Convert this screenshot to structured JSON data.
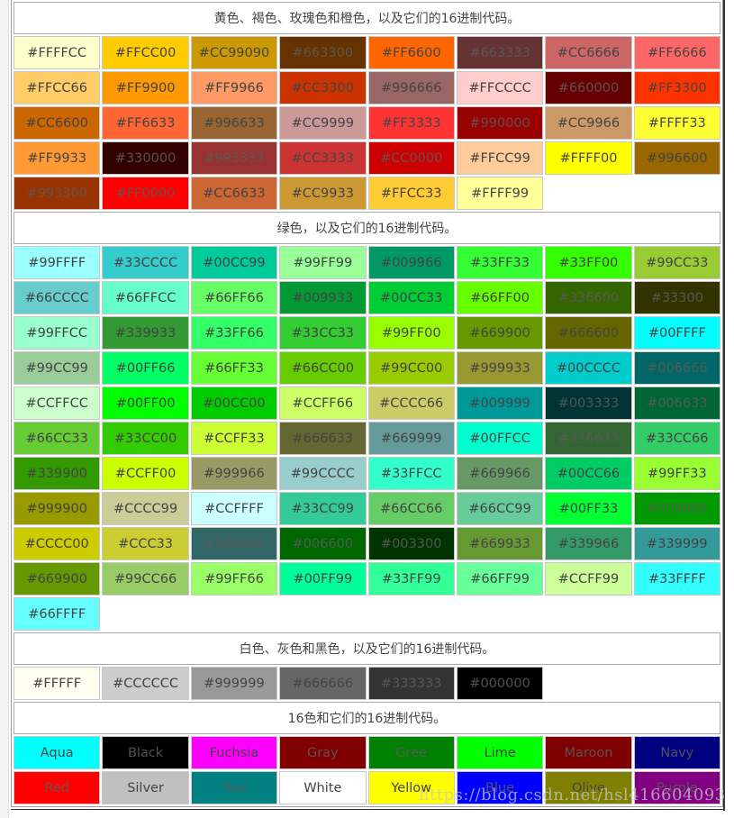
{
  "sections": [
    {
      "title": "黄色、褐色、玫瑰色和橙色，以及它们的16进制代码。",
      "rows": [
        [
          "#FFFFCC",
          "#FFCC00",
          "#CC99090",
          "#663300",
          "#FF6600",
          "#663333",
          "#CC6666",
          "#FF6666"
        ],
        [
          "#FFCC66",
          "#FF9900",
          "#FF9966",
          "#CC3300",
          "#996666",
          "#FFCCCC",
          "#660000",
          "#FF3300"
        ],
        [
          "#CC6600",
          "#FF6633",
          "#996633",
          "#CC9999",
          "#FF3333",
          "#990000",
          "#CC9966",
          "#FFFF33"
        ],
        [
          "#FF9933",
          "#330000",
          "#993333",
          "#CC3333",
          "#CC0000",
          "#FFCC99",
          "#FFFF00",
          "#996600"
        ],
        [
          "#993300",
          "#FF0000",
          "#CC6633",
          "#CC9933",
          "#FFCC33",
          "#FFFF99"
        ]
      ],
      "colors": [
        [
          "#FFFFCC",
          "#FFCC00",
          "#CC9900",
          "#663300",
          "#FF6600",
          "#663333",
          "#CC6666",
          "#FF6666"
        ],
        [
          "#FFCC66",
          "#FF9900",
          "#FF9966",
          "#CC3300",
          "#996666",
          "#FFCCCC",
          "#660000",
          "#FF3300"
        ],
        [
          "#CC6600",
          "#FF6633",
          "#996633",
          "#CC9999",
          "#FF3333",
          "#990000",
          "#CC9966",
          "#FFFF33"
        ],
        [
          "#FF9933",
          "#330000",
          "#993333",
          "#CC3333",
          "#CC0000",
          "#FFCC99",
          "#FFFF00",
          "#996600"
        ],
        [
          "#993300",
          "#FF0000",
          "#CC6633",
          "#CC9933",
          "#FFCC33",
          "#FFFF99"
        ]
      ]
    },
    {
      "title": "绿色，以及它们的16进制代码。",
      "rows": [
        [
          "#99FFFF",
          "#33CCCC",
          "#00CC99",
          "#99FF99",
          "#009966",
          "#33FF33",
          "#33FF00",
          "#99CC33"
        ],
        [
          "#66CCCC",
          "#66FFCC",
          "#66FF66",
          "#009933",
          "#00CC33",
          "#66FF00",
          "#336600",
          "#33300"
        ],
        [
          "#99FFCC",
          "#339933",
          "#33FF66",
          "#33CC33",
          "#99FF00",
          "#669900",
          "#666600",
          "#00FFFF"
        ],
        [
          "#99CC99",
          "#00FF66",
          "#66FF33",
          "#66CC00",
          "#99CC00",
          "#999933",
          "#00CCCC",
          "#006666"
        ],
        [
          "#CCFFCC",
          "#00FF00",
          "#00CC00",
          "#CCFF66",
          "#CCCC66",
          "#009999",
          "#003333",
          "#006633"
        ],
        [
          "#66CC33",
          "#33CC00",
          "#CCFF33",
          "#666633",
          "#669999",
          "#00FFCC",
          "#336633",
          "#33CC66"
        ],
        [
          "#339900",
          "#CCFF00",
          "#999966",
          "#99CCCC",
          "#33FFCC",
          "#669966",
          "#00CC66",
          "#99FF33"
        ],
        [
          "#999900",
          "#CCCC99",
          "#CCFFFF",
          "#33CC99",
          "#66CC66",
          "#66CC99",
          "#00FF33",
          "#009900"
        ],
        [
          "#CCCC00",
          "#CCC33",
          "#336666",
          "#006600",
          "#003300",
          "#669933",
          "#339966",
          "#339999"
        ],
        [
          "#669900",
          "#99CC66",
          "#99FF66",
          "#00FF99",
          "#33FF99",
          "#66FF99",
          "#CCFF99",
          "#33FFFF"
        ],
        [
          "#66FFFF"
        ]
      ],
      "colors": [
        [
          "#99FFFF",
          "#33CCCC",
          "#00CC99",
          "#99FF99",
          "#009966",
          "#33FF33",
          "#33FF00",
          "#99CC33"
        ],
        [
          "#66CCCC",
          "#66FFCC",
          "#66FF66",
          "#009933",
          "#00CC33",
          "#66FF00",
          "#336600",
          "#333300"
        ],
        [
          "#99FFCC",
          "#339933",
          "#33FF66",
          "#33CC33",
          "#99FF00",
          "#669900",
          "#666600",
          "#00FFFF"
        ],
        [
          "#99CC99",
          "#00FF66",
          "#66FF33",
          "#66CC00",
          "#99CC00",
          "#999933",
          "#00CCCC",
          "#006666"
        ],
        [
          "#CCFFCC",
          "#00FF00",
          "#00CC00",
          "#CCFF66",
          "#CCCC66",
          "#009999",
          "#003333",
          "#006633"
        ],
        [
          "#66CC33",
          "#33CC00",
          "#CCFF33",
          "#666633",
          "#669999",
          "#00FFCC",
          "#336633",
          "#33CC66"
        ],
        [
          "#339900",
          "#CCFF00",
          "#999966",
          "#99CCCC",
          "#33FFCC",
          "#669966",
          "#00CC66",
          "#99FF33"
        ],
        [
          "#999900",
          "#CCCC99",
          "#CCFFFF",
          "#33CC99",
          "#66CC66",
          "#66CC99",
          "#00FF33",
          "#009900"
        ],
        [
          "#CCCC00",
          "#CCCC33",
          "#336666",
          "#006600",
          "#003300",
          "#669933",
          "#339966",
          "#339999"
        ],
        [
          "#669900",
          "#99CC66",
          "#99FF66",
          "#00FF99",
          "#33FF99",
          "#66FF99",
          "#CCFF99",
          "#33FFFF"
        ],
        [
          "#66FFFF"
        ]
      ]
    },
    {
      "title": "白色、灰色和黑色，以及它们的16进制代码。",
      "rows": [
        [
          "#FFFFF",
          "#CCCCCC",
          "#999999",
          "#666666",
          "#333333",
          "#000000"
        ]
      ],
      "colors": [
        [
          "#FFFFF0",
          "#CCCCCC",
          "#999999",
          "#666666",
          "#333333",
          "#000000"
        ]
      ]
    },
    {
      "title": "16色和它们的16进制代码。",
      "rows": [
        [
          "Aqua",
          "Black",
          "Fuchsia",
          "Gray",
          "Gree",
          "Lime",
          "Maroon",
          "Navy"
        ],
        [
          "Red",
          "Silver",
          "Teal",
          "White",
          "Yellow",
          "Blue",
          "Olive",
          "Purple"
        ]
      ],
      "colors": [
        [
          "#00FFFF",
          "#000000",
          "#FF00FF",
          "#800000",
          "#008000",
          "#00FF00",
          "#800000",
          "#000080"
        ],
        [
          "#FF0000",
          "#C0C0C0",
          "#008080",
          "#FFFFFF",
          "#FFFF00",
          "#0000FF",
          "#808000",
          "#800080"
        ]
      ]
    }
  ],
  "watermark": "https://blog.csdn.net/hsl416604093"
}
